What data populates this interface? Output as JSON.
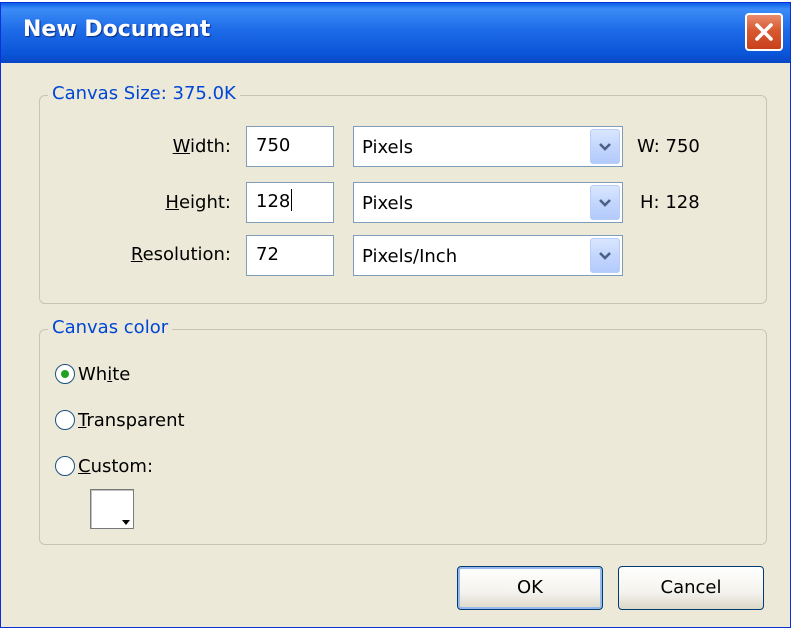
{
  "window": {
    "title": "New Document"
  },
  "canvas_size": {
    "legend": "Canvas Size: 375.0K",
    "rows": [
      {
        "label": "Width:",
        "mnemonic": "W",
        "label_rest": "idth:",
        "value": "750",
        "unit": "Pixels",
        "readout": "W: 750"
      },
      {
        "label": "Height:",
        "mnemonic": "H",
        "label_rest": "eight:",
        "value": "128",
        "unit": "Pixels",
        "readout": "H: 128"
      },
      {
        "label": "Resolution:",
        "mnemonic": "R",
        "label_rest": "esolution:",
        "value": "72",
        "unit": "Pixels/Inch",
        "readout": ""
      }
    ]
  },
  "canvas_color": {
    "legend": "Canvas color",
    "selected": "White",
    "options": [
      {
        "label": "White",
        "pre": "Wh",
        "mnemonic": "i",
        "post": "te"
      },
      {
        "label": "Transparent",
        "pre": "",
        "mnemonic": "T",
        "post": "ransparent"
      },
      {
        "label": "Custom:",
        "pre": "",
        "mnemonic": "C",
        "post": "ustom:"
      }
    ],
    "custom_swatch_color": "#ffffff"
  },
  "buttons": {
    "ok_label": "OK",
    "cancel_label": "Cancel"
  },
  "theme": {
    "title_bar": "#0a55d8",
    "close_button": "#d85a30",
    "legend_text": "#0046d5",
    "radio_selected": "#21a121",
    "dialog_background": "#ece9d8"
  }
}
